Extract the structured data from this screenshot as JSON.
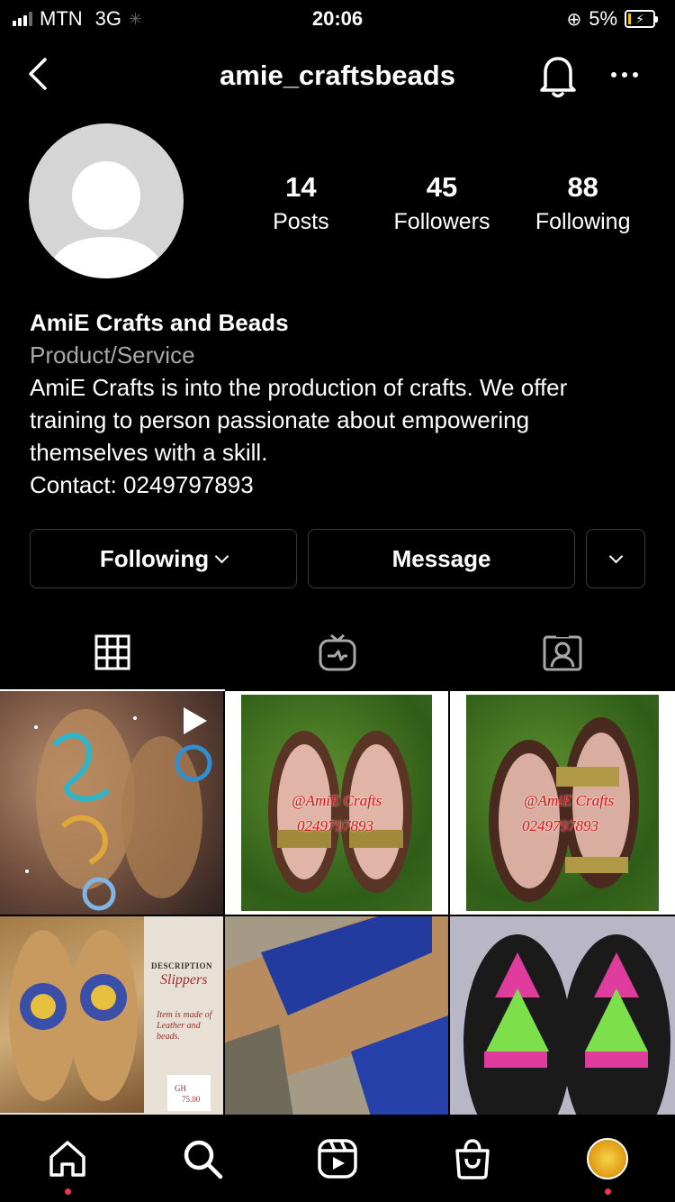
{
  "status_bar": {
    "carrier": "MTN",
    "network": "3G",
    "time": "20:06",
    "battery": "5%"
  },
  "header": {
    "username": "amie_craftsbeads"
  },
  "stats": [
    {
      "num": "14",
      "label": "Posts"
    },
    {
      "num": "45",
      "label": "Followers"
    },
    {
      "num": "88",
      "label": "Following"
    }
  ],
  "bio": {
    "name": "AmiE Crafts and Beads",
    "category": "Product/Service",
    "line1": "AmiE Crafts is into the production of crafts. We offer",
    "line2": "training to person passionate about empowering",
    "line3": "themselves with a skill.",
    "contact": "Contact: 0249797893"
  },
  "buttons": {
    "following": "Following",
    "message": "Message"
  },
  "posts": [
    {
      "watermark": ""
    },
    {
      "watermark": "@AmiE Crafts",
      "phone": "0249797893"
    },
    {
      "watermark": "@AmiE Crafts",
      "phone": "0249797893"
    },
    {
      "desc_title": "DESCRIPTION",
      "desc_sub": "Slippers",
      "desc_body1": "Item is made of",
      "desc_body2": "Leather and",
      "desc_body3": "beads.",
      "price1": "GH",
      "price2": "75.00"
    },
    {
      "watermark": ""
    },
    {
      "watermark": ""
    }
  ],
  "colors": {
    "accent_dot": "#f0364f",
    "background": "#000000"
  }
}
